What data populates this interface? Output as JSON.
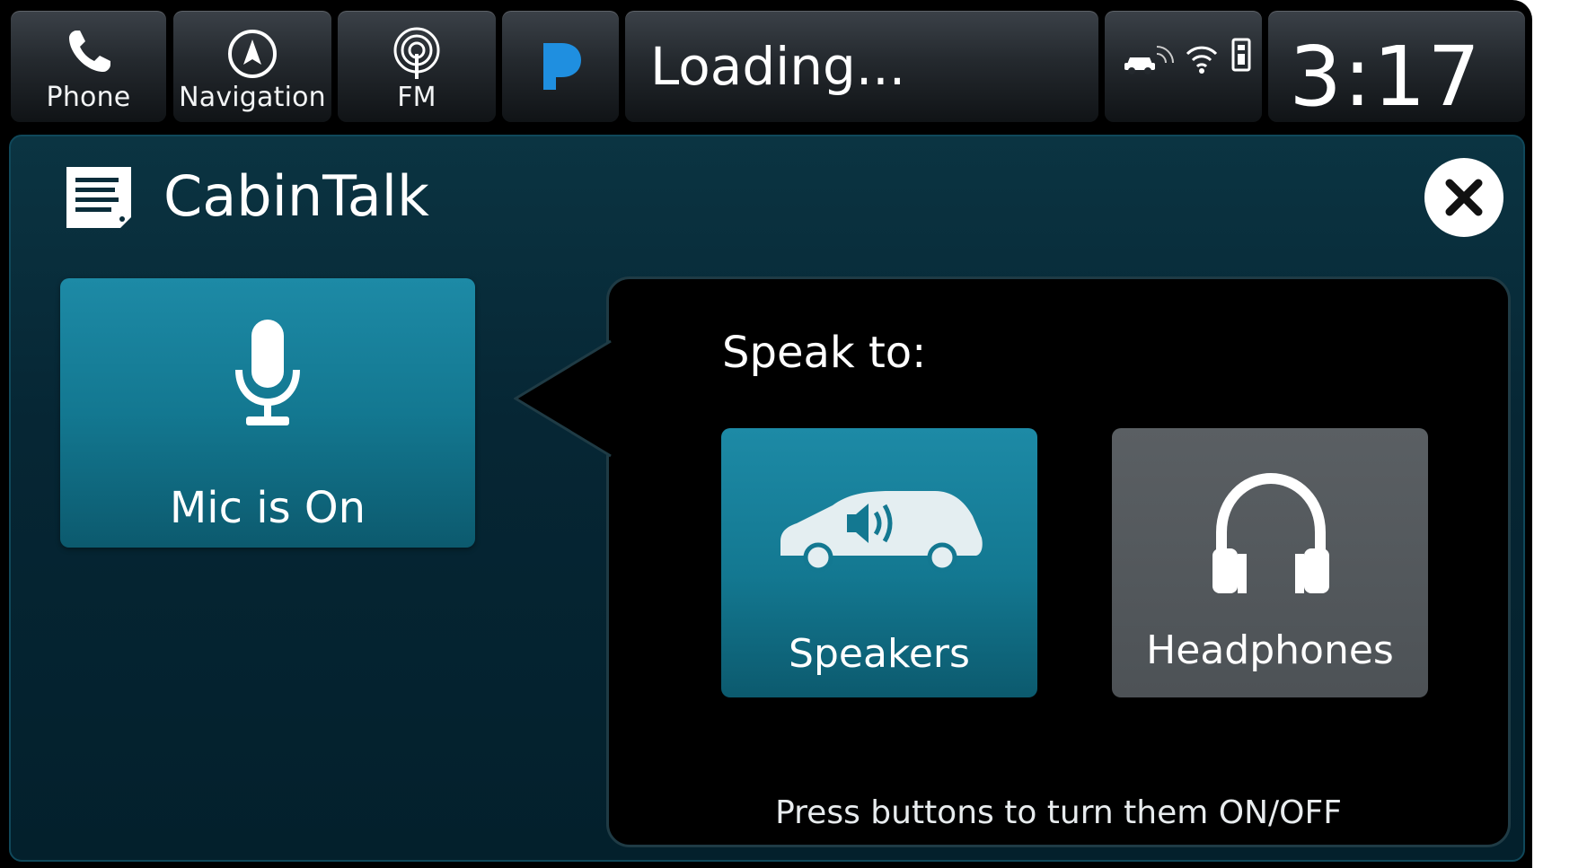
{
  "status_bar": {
    "shortcuts": [
      {
        "label": "Phone",
        "icon": "phone-icon"
      },
      {
        "label": "Navigation",
        "icon": "compass-icon"
      },
      {
        "label": "FM",
        "icon": "radio-fm-icon"
      }
    ],
    "media_source_icon": "pandora-icon",
    "media_status": "Loading...",
    "indicators": [
      "car-connectivity-icon",
      "wifi-icon",
      "usb-icon"
    ],
    "clock": "3:17"
  },
  "panel": {
    "title": "CabinTalk",
    "title_icon": "note-icon",
    "close_icon": "close-icon",
    "mic_button": {
      "label": "Mic is On",
      "icon": "microphone-icon",
      "active": true
    },
    "speak_to": {
      "title": "Speak to:",
      "options": [
        {
          "label": "Speakers",
          "icon": "car-speaker-icon",
          "active": true
        },
        {
          "label": "Headphones",
          "icon": "headphones-icon",
          "active": false
        }
      ],
      "hint": "Press buttons to turn them ON/OFF"
    }
  },
  "colors": {
    "accent_active": "#137891",
    "inactive_button": "#53585c",
    "panel_bg": "#062634",
    "pandora_blue": "#1f8fe0"
  }
}
